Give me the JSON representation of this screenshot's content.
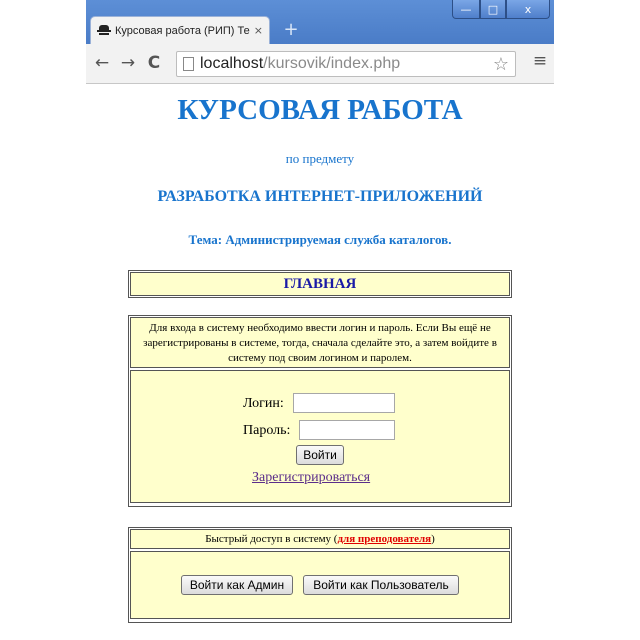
{
  "browser": {
    "tab_title": "Курсовая работа (РИП) Тема",
    "tab_close": "×",
    "new_tab": "+",
    "url_host": "localhost",
    "url_path": "/kursovik/index.php",
    "back": "←",
    "forward": "→",
    "reload": "C",
    "bookmark": "☆",
    "menu": "≡",
    "window_min": "—",
    "window_max": "□",
    "window_close": "x"
  },
  "page": {
    "title": "КУРСОВАЯ РАБОТА",
    "subtitle": "по предмету",
    "subject": "РАЗРАБОТКА ИНТЕРНЕТ-ПРИЛОЖЕНИЙ",
    "topic": "Тема: Администрируемая служба каталогов."
  },
  "nav": {
    "home_label": "ГЛАВНАЯ"
  },
  "login": {
    "info_text": "Для входа в систему необходимо ввести логин и пароль. Если Вы ещё не зарегистрированы в системе, тогда, сначала сделайте это, а затем войдите в систему под своим логином и паролем.",
    "login_label": "Логин:",
    "password_label": "Пароль:",
    "login_value": "",
    "password_value": "",
    "submit_label": "Войти",
    "register_label": "Зарегистрироваться"
  },
  "quick_access": {
    "header_text": "Быстрый доступ в систему (",
    "header_highlight": "для преподователя",
    "header_end": ")",
    "admin_button": "Войти как Админ",
    "user_button": "Войти как Пользователь"
  },
  "colors": {
    "heading_blue": "#1874cd",
    "cell_yellow": "#ffffcc",
    "highlight_red": "#e00000"
  }
}
